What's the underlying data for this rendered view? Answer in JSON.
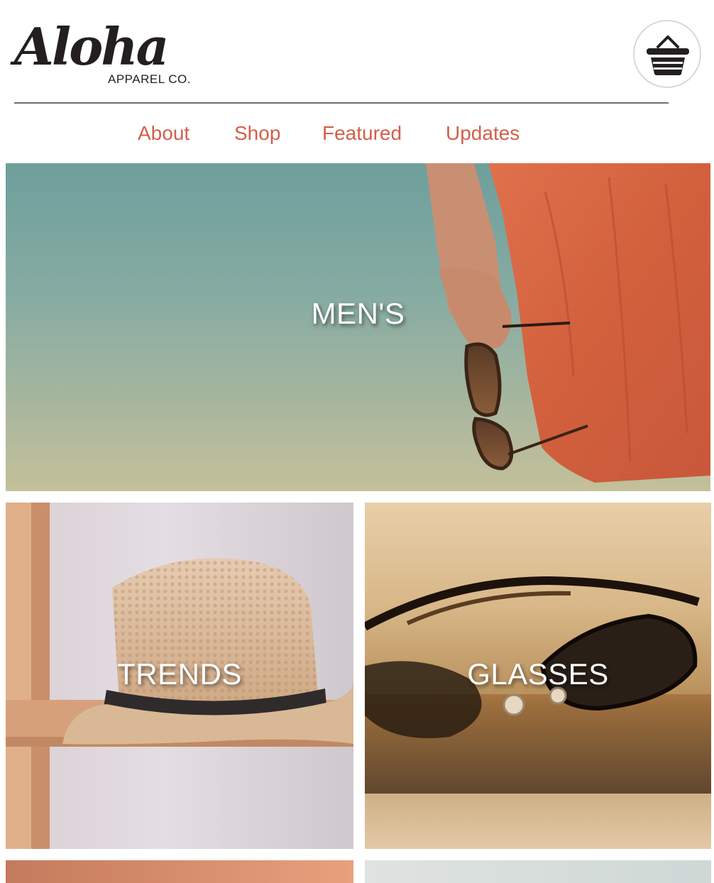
{
  "brand": {
    "logo_script": "Aloha",
    "logo_subtitle": "APPAREL CO."
  },
  "cart": {
    "icon": "basket-icon"
  },
  "nav": {
    "items": [
      {
        "label": "About"
      },
      {
        "label": "Shop"
      },
      {
        "label": "Featured"
      },
      {
        "label": "Updates"
      }
    ]
  },
  "categories": [
    {
      "label": "MEN'S"
    },
    {
      "label": "TRENDS"
    },
    {
      "label": "GLASSES"
    }
  ],
  "colors": {
    "nav_link": "#d35f4b",
    "text_dark": "#231f20",
    "divider": "#6f6f6f"
  }
}
